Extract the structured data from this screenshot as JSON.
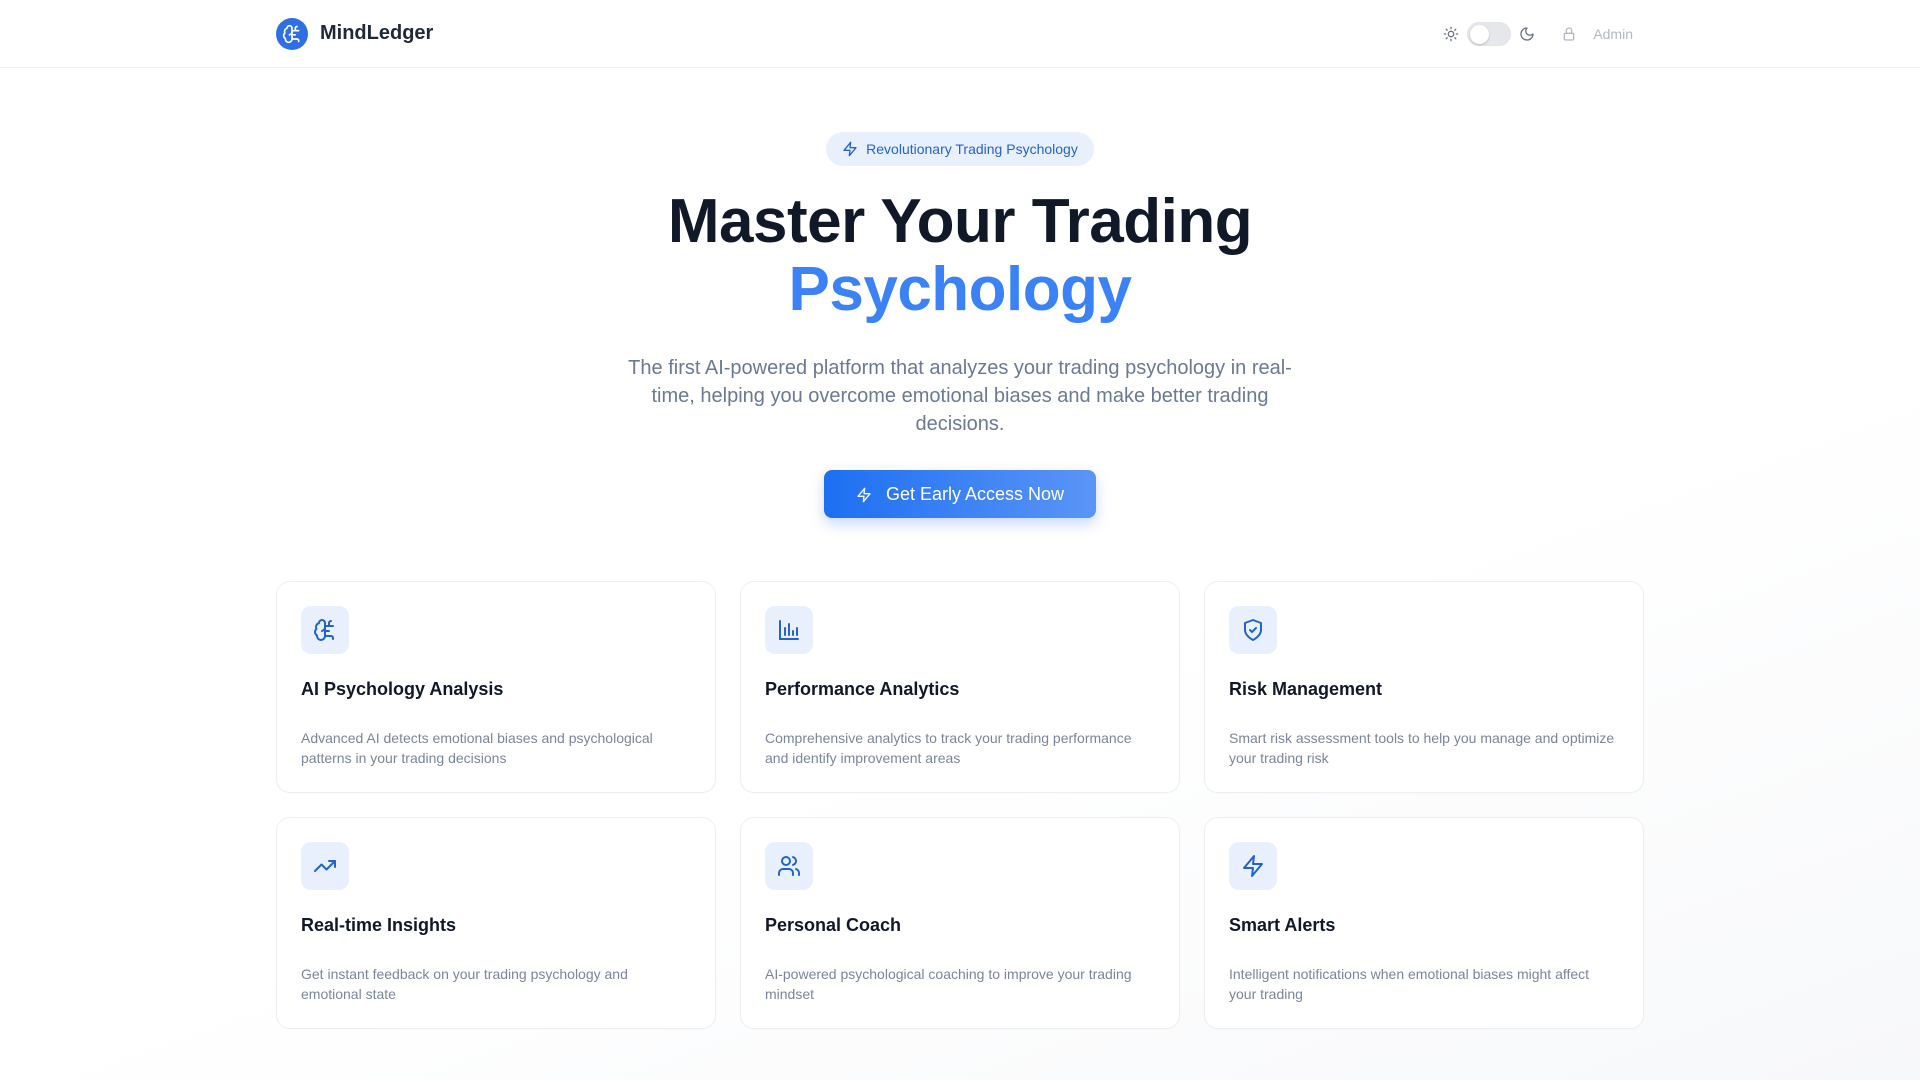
{
  "header": {
    "brand_name": "MindLedger",
    "admin_label": "Admin",
    "theme_toggle": "light"
  },
  "hero": {
    "badge_text": "Revolutionary Trading Psychology",
    "title_line1": "Master Your Trading",
    "title_line2": "Psychology",
    "subtitle": "The first AI-powered platform that analyzes your trading psychology in real-time, helping you overcome emotional biases and make better trading decisions.",
    "cta_label": "Get Early Access Now"
  },
  "features": [
    {
      "title": "AI Psychology Analysis",
      "desc": "Advanced AI detects emotional biases and psychological patterns in your trading decisions",
      "icon": "brain-icon"
    },
    {
      "title": "Performance Analytics",
      "desc": "Comprehensive analytics to track your trading performance and identify improvement areas",
      "icon": "bar-chart-icon"
    },
    {
      "title": "Risk Management",
      "desc": "Smart risk assessment tools to help you manage and optimize your trading risk",
      "icon": "shield-check-icon"
    },
    {
      "title": "Real-time Insights",
      "desc": "Get instant feedback on your trading psychology and emotional state",
      "icon": "trending-up-icon"
    },
    {
      "title": "Personal Coach",
      "desc": "AI-powered psychological coaching to improve your trading mindset",
      "icon": "users-icon"
    },
    {
      "title": "Smart Alerts",
      "desc": "Intelligent notifications when emotional biases might affect your trading",
      "icon": "zap-icon"
    }
  ],
  "colors": {
    "accent": "#3b82f6",
    "brand": "#2f6fe4",
    "badge_bg": "#e8f0fd"
  }
}
